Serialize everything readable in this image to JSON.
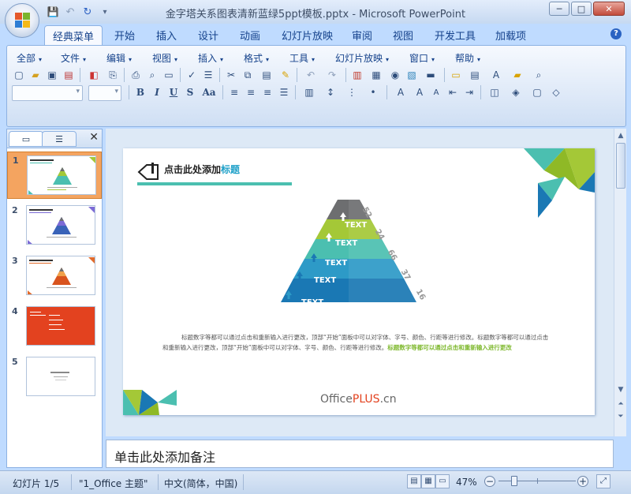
{
  "window": {
    "title": "金字塔关系图表清新蓝绿5ppt模板.pptx - Microsoft PowerPoint",
    "minimize": "─",
    "maximize": "□",
    "close": "✕"
  },
  "qat": {
    "save": "💾",
    "undo": "↶",
    "redo": "↻",
    "more": "▾"
  },
  "tabs": [
    "经典菜单",
    "开始",
    "插入",
    "设计",
    "动画",
    "幻灯片放映",
    "审阅",
    "视图",
    "开发工具",
    "加载项"
  ],
  "help": "?",
  "menus": [
    "全部",
    "文件",
    "编辑",
    "视图",
    "插入",
    "格式",
    "工具",
    "幻灯片放映",
    "窗口",
    "帮助"
  ],
  "format_buttons": {
    "bold": "B",
    "italic": "I",
    "underline": "U",
    "strike": "S",
    "case": "Aa"
  },
  "panel": {
    "close": "✕"
  },
  "thumbnails": [
    {
      "num": "1"
    },
    {
      "num": "2"
    },
    {
      "num": "3"
    },
    {
      "num": "4"
    },
    {
      "num": "5"
    }
  ],
  "slide": {
    "title_prefix": "点击此处添加",
    "title_suffix": "标题",
    "levels": [
      "TEXT",
      "TEXT",
      "TEXT",
      "TEXT",
      "TEXT"
    ],
    "values": [
      "52",
      "24",
      "66",
      "37",
      "16"
    ],
    "body_text_1": "标题数字等都可以通过点击和重新输入进行更改，顶部“开始”面板中可以对字体、字号、颜色、行距等进行修改。标题数字等都可以通过点击和重新输入进行更改，顶部“开始”面板中可以对字体、字号、颜色、行距等进行修改。",
    "body_text_green": "标题数字等都可以通过点击和重新输入进行更改",
    "logo_office": "Office",
    "logo_plus": "PLUS",
    "logo_cn": ".cn"
  },
  "notes_placeholder": "单击此处添加备注",
  "status": {
    "slide_count": "幻灯片 1/5",
    "theme": "\"1_Office 主题\"",
    "language": "中文(简体，中国)",
    "zoom": "47%"
  },
  "colors": {
    "accent_green": "#a4c837",
    "accent_teal": "#4bbfb0",
    "accent_blue": "#1a78b4",
    "pyramid_top": "#6d6e70",
    "title_blue": "#1ea0c8"
  }
}
